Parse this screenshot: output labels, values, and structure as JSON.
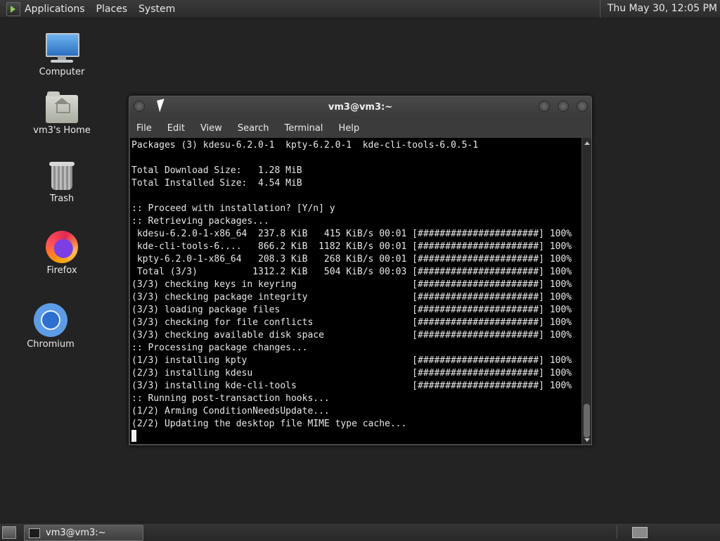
{
  "top_panel": {
    "menus": [
      "Applications",
      "Places",
      "System"
    ],
    "clock": "Thu May 30, 12:05 PM"
  },
  "desktop_icons": [
    {
      "label": "Computer",
      "icon": "computer-icon"
    },
    {
      "label": "vm3's Home",
      "icon": "home-folder-icon"
    },
    {
      "label": "Trash",
      "icon": "trash-icon"
    },
    {
      "label": "Firefox",
      "icon": "firefox-icon"
    },
    {
      "label": "Chromium",
      "icon": "chromium-icon"
    }
  ],
  "terminal": {
    "title": "vm3@vm3:~",
    "menu": [
      "File",
      "Edit",
      "View",
      "Search",
      "Terminal",
      "Help"
    ],
    "lines": [
      "Packages (3) kdesu-6.2.0-1  kpty-6.2.0-1  kde-cli-tools-6.0.5-1",
      "",
      "Total Download Size:   1.28 MiB",
      "Total Installed Size:  4.54 MiB",
      "",
      ":: Proceed with installation? [Y/n] y",
      ":: Retrieving packages...",
      " kdesu-6.2.0-1-x86_64  237.8 KiB   415 KiB/s 00:01 [######################] 100%",
      " kde-cli-tools-6....   866.2 KiB  1182 KiB/s 00:01 [######################] 100%",
      " kpty-6.2.0-1-x86_64   208.3 KiB   268 KiB/s 00:01 [######################] 100%",
      " Total (3/3)          1312.2 KiB   504 KiB/s 00:03 [######################] 100%",
      "(3/3) checking keys in keyring                     [######################] 100%",
      "(3/3) checking package integrity                   [######################] 100%",
      "(3/3) loading package files                        [######################] 100%",
      "(3/3) checking for file conflicts                  [######################] 100%",
      "(3/3) checking available disk space                [######################] 100%",
      ":: Processing package changes...",
      "(1/3) installing kpty                              [######################] 100%",
      "(2/3) installing kdesu                             [######################] 100%",
      "(3/3) installing kde-cli-tools                     [######################] 100%",
      ":: Running post-transaction hooks...",
      "(1/2) Arming ConditionNeedsUpdate...",
      "(2/2) Updating the desktop file MIME type cache..."
    ]
  },
  "taskbar": {
    "window_button": "vm3@vm3:~"
  }
}
